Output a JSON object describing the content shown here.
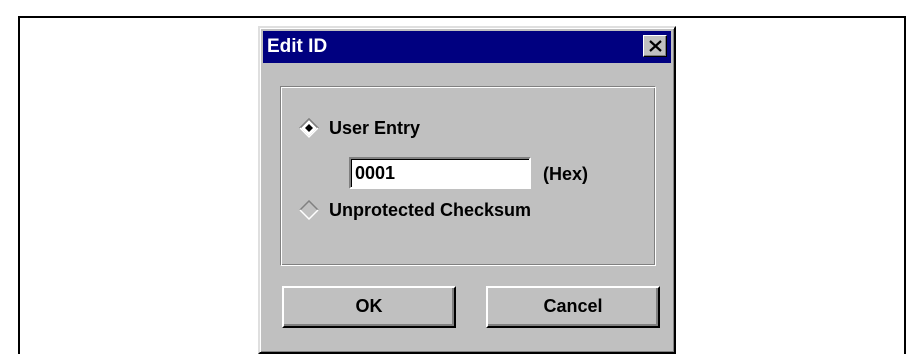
{
  "dialog": {
    "title": "Edit ID",
    "close_icon": "close-icon"
  },
  "group": {
    "options": [
      {
        "label": "User Entry",
        "selected": true
      },
      {
        "label": "Unprotected Checksum",
        "selected": false
      }
    ],
    "id_input": {
      "value": "0001",
      "suffix": "(Hex)"
    }
  },
  "buttons": {
    "ok_label": "OK",
    "cancel_label": "Cancel"
  },
  "colors": {
    "titlebar": "#000080",
    "face": "#c0c0c0"
  }
}
